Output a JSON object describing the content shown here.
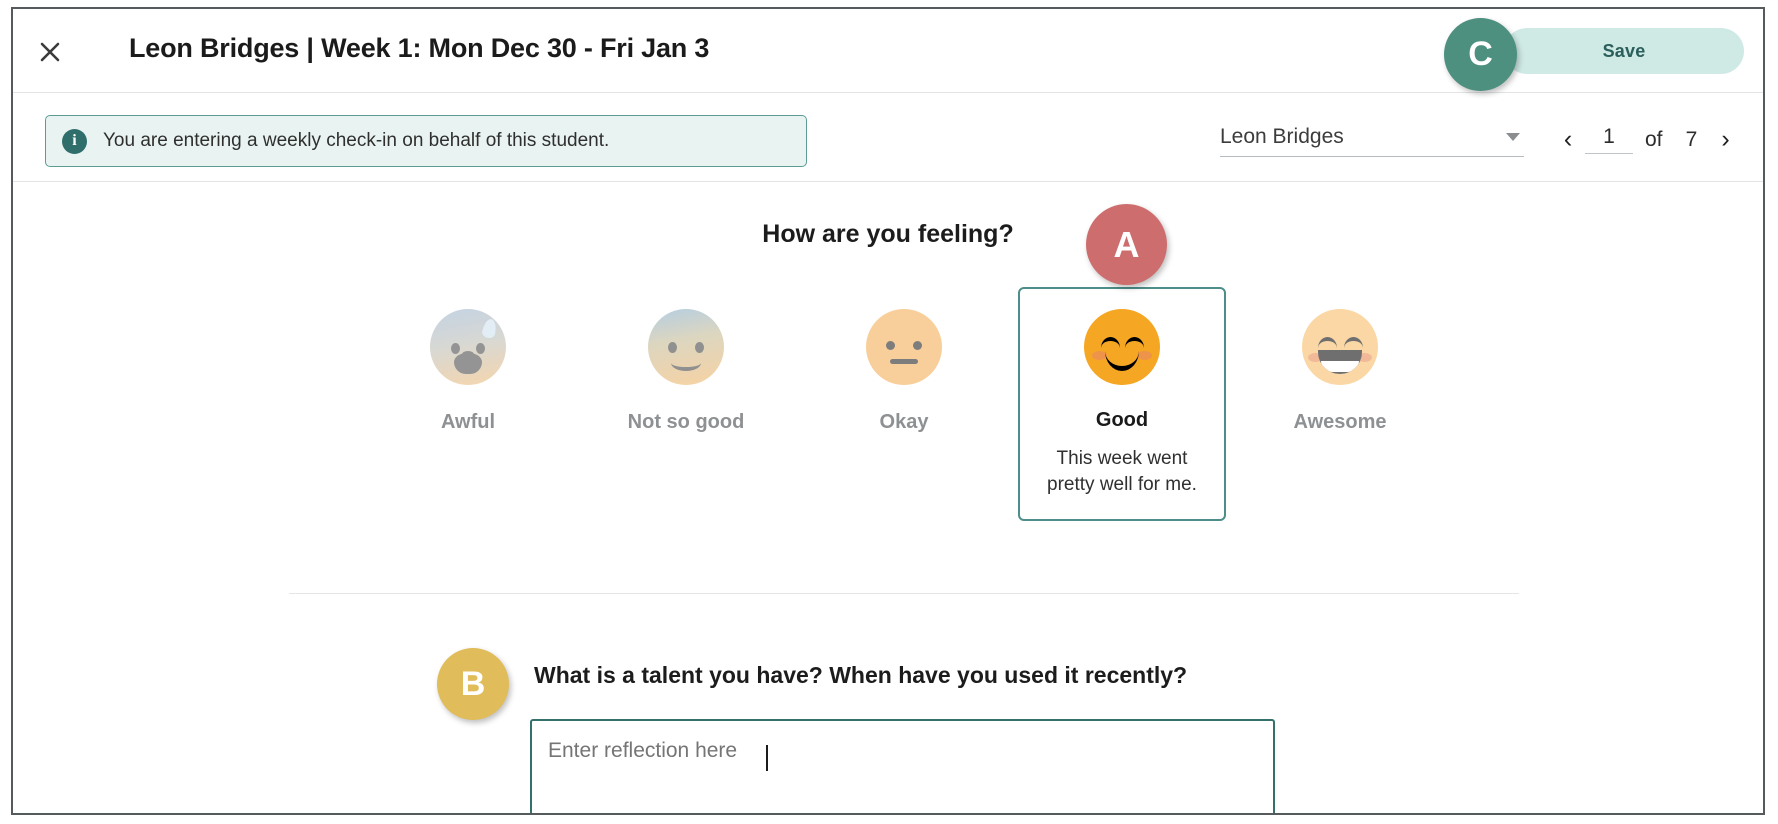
{
  "header": {
    "close_icon": "close-icon",
    "title": "Leon Bridges | Week 1: Mon Dec 30 - Fri Jan 3",
    "save_label": "Save"
  },
  "annotations": [
    {
      "id": "A",
      "label": "A",
      "color": "#cd6d6d"
    },
    {
      "id": "B",
      "label": "B",
      "color": "#e0bc5a"
    },
    {
      "id": "C",
      "label": "C",
      "color": "#4e9080"
    }
  ],
  "banner": {
    "icon": "info-icon",
    "icon_glyph": "i",
    "text": "You are entering a weekly check-in on behalf of this student."
  },
  "student_nav": {
    "selected_student": "Leon Bridges",
    "dropdown_icon": "chevron-down-icon",
    "prev_icon": "‹",
    "next_icon": "›",
    "current_page": "1",
    "of_label": "of",
    "total_pages": "7"
  },
  "mood": {
    "question": "How are you feeling?",
    "options": [
      {
        "label": "Awful",
        "face": "awful",
        "selected": false,
        "description": ""
      },
      {
        "label": "Not so good",
        "face": "notgood",
        "selected": false,
        "description": ""
      },
      {
        "label": "Okay",
        "face": "okay",
        "selected": false,
        "description": ""
      },
      {
        "label": "Good",
        "face": "good",
        "selected": true,
        "description": "This week went pretty well for me."
      },
      {
        "label": "Awesome",
        "face": "awesome",
        "selected": false,
        "description": ""
      }
    ]
  },
  "reflection": {
    "question": "What is a talent you have? When have you used it recently?",
    "placeholder": "Enter reflection here",
    "value": ""
  },
  "colors": {
    "accent_teal": "#34706c",
    "save_bg": "#cfe9e5",
    "banner_bg": "#e9f4f2",
    "selected_border": "#4d8e8a"
  }
}
